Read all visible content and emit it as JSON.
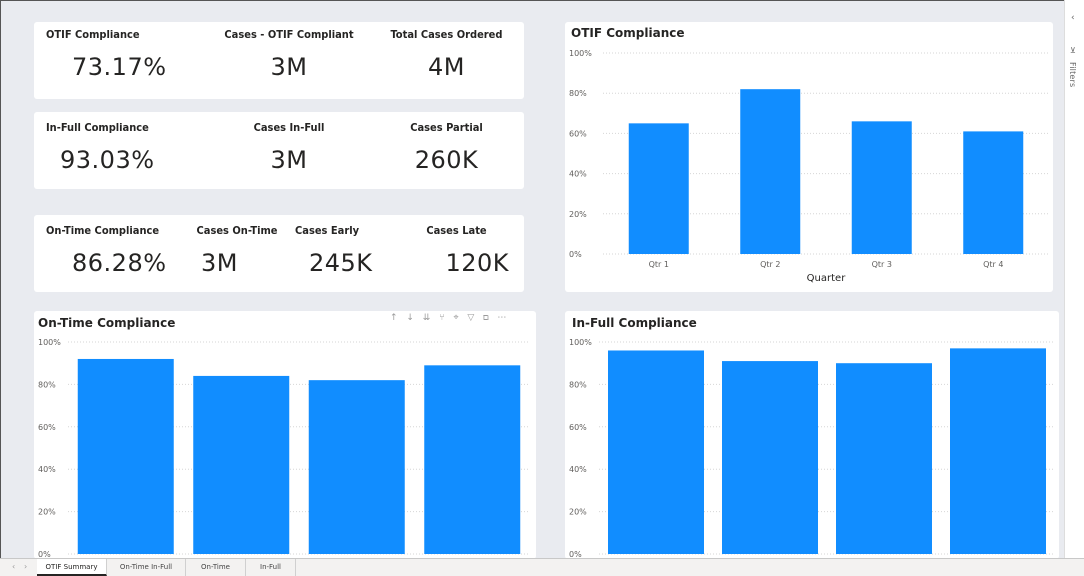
{
  "kpi_rows": [
    {
      "items": [
        {
          "label": "OTIF Compliance",
          "value": "73.17%"
        },
        {
          "label": "Cases - OTIF Compliant",
          "value": "3M"
        },
        {
          "label": "Total Cases Ordered",
          "value": "4M"
        }
      ]
    },
    {
      "items": [
        {
          "label": "In-Full Compliance",
          "value": "93.03%"
        },
        {
          "label": "Cases In-Full",
          "value": "3M"
        },
        {
          "label": "Cases Partial",
          "value": "260K"
        }
      ]
    },
    {
      "items": [
        {
          "label": "On-Time Compliance",
          "value": "86.28%"
        },
        {
          "label": "Cases On-Time",
          "value": "3M"
        },
        {
          "label": "Cases Early",
          "value": "245K"
        },
        {
          "label": "Cases Late",
          "value": "120K"
        }
      ]
    }
  ],
  "visual_header_icons": "↑ ↓ ⇊ ⑂ ⌖ ▽ ⧉ ⋯",
  "filters_pane": {
    "label": "Filters",
    "collapse_icon": "‹",
    "filter_icon": "⊻"
  },
  "tabs": {
    "nav_prev": "‹",
    "nav_next": "›",
    "items": [
      "OTIF Summary",
      "On-Time In-Full",
      "On-Time",
      "In-Full"
    ],
    "active": "OTIF Summary"
  },
  "colors": {
    "bar": "#118dff",
    "background": "#e9ebf0",
    "card": "#ffffff"
  },
  "chart_data": [
    {
      "type": "bar",
      "title": "OTIF Compliance",
      "xlabel": "Quarter",
      "ylabel": "",
      "categories": [
        "Qtr 1",
        "Qtr 2",
        "Qtr 3",
        "Qtr 4"
      ],
      "values": [
        65,
        82,
        66,
        61
      ],
      "yticks": [
        "0%",
        "20%",
        "40%",
        "60%",
        "80%",
        "100%"
      ],
      "ylim": [
        0,
        100
      ],
      "grid": true
    },
    {
      "type": "bar",
      "title": "On-Time Compliance",
      "xlabel": "",
      "ylabel": "",
      "categories": [
        "",
        "",
        "",
        ""
      ],
      "values": [
        92,
        84,
        82,
        89
      ],
      "yticks": [
        "0%",
        "20%",
        "40%",
        "60%",
        "80%",
        "100%"
      ],
      "ylim": [
        0,
        100
      ],
      "grid": true
    },
    {
      "type": "bar",
      "title": "In-Full Compliance",
      "xlabel": "",
      "ylabel": "",
      "categories": [
        "",
        "",
        "",
        ""
      ],
      "values": [
        96,
        91,
        90,
        97
      ],
      "yticks": [
        "0%",
        "20%",
        "40%",
        "60%",
        "80%",
        "100%"
      ],
      "ylim": [
        0,
        100
      ],
      "grid": true
    }
  ]
}
